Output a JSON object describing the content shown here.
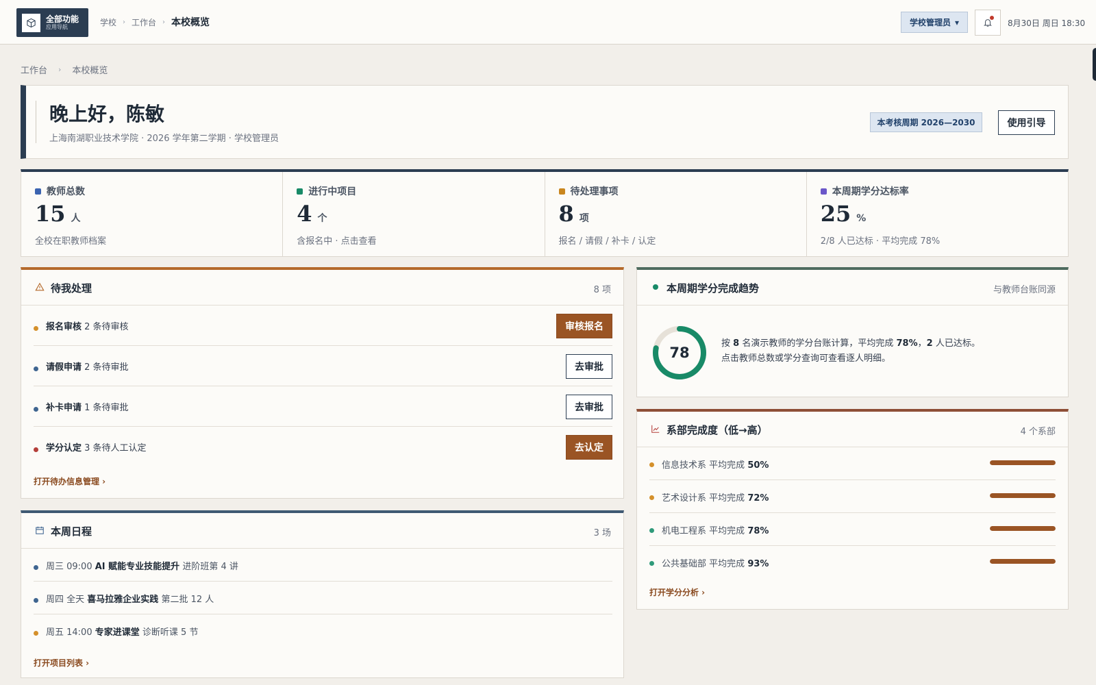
{
  "app_nav": {
    "title": "全部功能",
    "subtitle": "应用导航"
  },
  "top_breadcrumb": [
    "学校",
    "工作台",
    "本校概览"
  ],
  "role_selector": {
    "label": "学校管理员"
  },
  "datetime": "8月30日 周日 18:30",
  "page_breadcrumb": [
    "工作台",
    "本校概览"
  ],
  "welcome": {
    "greeting": "晚上好，陈敏",
    "subtitle": "上海南湖职业技术学院 · 2026 学年第二学期 · 学校管理员",
    "period_badge": "本考核周期 2026—2030",
    "guide_button": "使用引导"
  },
  "stats": [
    {
      "label": "教师总数",
      "value": "15",
      "unit": "人",
      "hint": "全校在职教师档案",
      "color": "#3b63b0"
    },
    {
      "label": "进行中项目",
      "value": "4",
      "unit": "个",
      "hint": "含报名中 · 点击查看",
      "color": "#188a67"
    },
    {
      "label": "待处理事项",
      "value": "8",
      "unit": "项",
      "hint": "报名 / 请假 / 补卡 / 认定",
      "color": "#c9861e"
    },
    {
      "label": "本周期学分达标率",
      "value": "25",
      "unit": "%",
      "hint": "2/8 人已达标 · 平均完成 78%",
      "color": "#6b57c9"
    }
  ],
  "todo": {
    "title": "待我处理",
    "count": "8 项",
    "accent": "#b4692b",
    "items": [
      {
        "name": "报名审核",
        "detail": "2 条待审核",
        "button": "审核报名",
        "dot": "#d4902b"
      },
      {
        "name": "请假申请",
        "detail": "2 条待审批",
        "button": "去审批",
        "dot": "#3f6590"
      },
      {
        "name": "补卡申请",
        "detail": "1 条待审批",
        "button": "去审批",
        "dot": "#3f6590"
      },
      {
        "name": "学分认定",
        "detail": "3 条待人工认定",
        "button": "去认定",
        "dot": "#b43f3a"
      }
    ],
    "link": "打开待办信息管理 ›"
  },
  "schedule": {
    "title": "本周日程",
    "count": "3 场",
    "accent": "#3f5a73",
    "items": [
      {
        "time": "周三 09:00",
        "name": "AI 赋能专业技能提升",
        "detail": "进阶班第 4 讲",
        "dot": "#3f6590"
      },
      {
        "time": "周四 全天",
        "name": "喜马拉雅企业实践",
        "detail": "第二批 12 人",
        "dot": "#3f6590"
      },
      {
        "time": "周五 14:00",
        "name": "专家进课堂",
        "detail": "诊断听课 5 节",
        "dot": "#d4902b"
      }
    ],
    "link": "打开项目列表 ›"
  },
  "trend": {
    "title": "本周期学分完成趋势",
    "right": "与教师台账同源",
    "accent": "#4e6b5e",
    "percent": 78,
    "percent_label": "78",
    "ring_color": "#188a67",
    "line1_a": "按",
    "line1_teachers": "8",
    "line1_b": "名演示教师的学分台账计算，平均完成",
    "line1_avg": "78%",
    "line1_c": "，",
    "line1_reached": "2",
    "line1_d": "人已达标。",
    "line2": "点击教师总数或学分查询可查看逐人明细。"
  },
  "departments": {
    "title": "系部完成度（低→高）",
    "count": "4 个系部",
    "accent": "#8e4e36",
    "items": [
      {
        "name": "信息技术系",
        "label": "平均完成",
        "value": "50%",
        "progress": 100,
        "dot": "#d4902b"
      },
      {
        "name": "艺术设计系",
        "label": "平均完成",
        "value": "72%",
        "progress": 100,
        "dot": "#d4902b"
      },
      {
        "name": "机电工程系",
        "label": "平均完成",
        "value": "78%",
        "progress": 100,
        "dot": "#2f9a7a"
      },
      {
        "name": "公共基础部",
        "label": "平均完成",
        "value": "93%",
        "progress": 100,
        "dot": "#2f9a7a"
      }
    ],
    "link": "打开学分分析 ›"
  }
}
